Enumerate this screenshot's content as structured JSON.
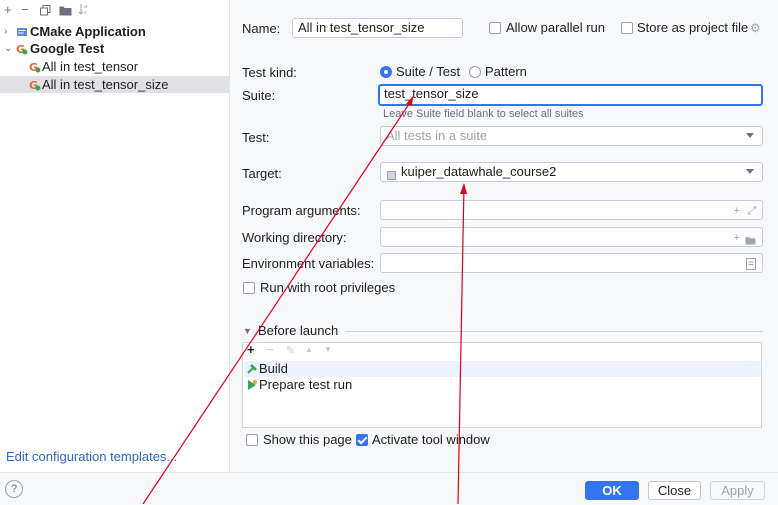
{
  "toolbar": {
    "add_icon": "+",
    "remove_icon": "−",
    "copy_icon": "copy-icon",
    "folder_icon": "folder-icon",
    "sort_icon": "sort-icon"
  },
  "tree": {
    "items": [
      {
        "label": "CMake Application",
        "icon": "cmake-icon",
        "expanded": false,
        "bold": true
      },
      {
        "label": "Google Test",
        "icon": "google-test-icon",
        "expanded": true,
        "bold": true
      },
      {
        "label": "All in test_tensor",
        "icon": "google-test-icon",
        "bold": false
      },
      {
        "label": "All in test_tensor_size",
        "icon": "google-test-icon",
        "bold": false,
        "selected": true
      }
    ]
  },
  "edit_templates_link": "Edit configuration templates...",
  "form": {
    "name_label": "Name:",
    "name_value": "All in test_tensor_size",
    "allow_parallel_label": "Allow parallel run",
    "store_project_label": "Store as project file",
    "test_kind_label": "Test kind:",
    "suite_test_option": "Suite / Test",
    "pattern_option": "Pattern",
    "suite_label": "Suite:",
    "suite_value": "test_tensor_size",
    "suite_hint": "Leave Suite field blank to select all suites",
    "test_label": "Test:",
    "test_placeholder": "All tests in a suite",
    "target_label": "Target:",
    "target_value": "kuiper_datawhale_course2",
    "program_args_label": "Program arguments:",
    "working_dir_label": "Working directory:",
    "env_vars_label": "Environment variables:",
    "root_priv_label": "Run with root privileges"
  },
  "before_launch": {
    "title": "Before launch",
    "items": [
      {
        "label": "Build",
        "icon": "build-hammer-icon"
      },
      {
        "label": "Prepare test run",
        "icon": "run-icon"
      }
    ],
    "show_page_label": "Show this page",
    "activate_tool_window_label": "Activate tool window"
  },
  "buttons": {
    "help": "?",
    "ok": "OK",
    "close": "Close",
    "apply": "Apply"
  },
  "colors": {
    "accent": "#3574f0",
    "annotation_line": "#e0001a",
    "link": "#2f65ca"
  }
}
